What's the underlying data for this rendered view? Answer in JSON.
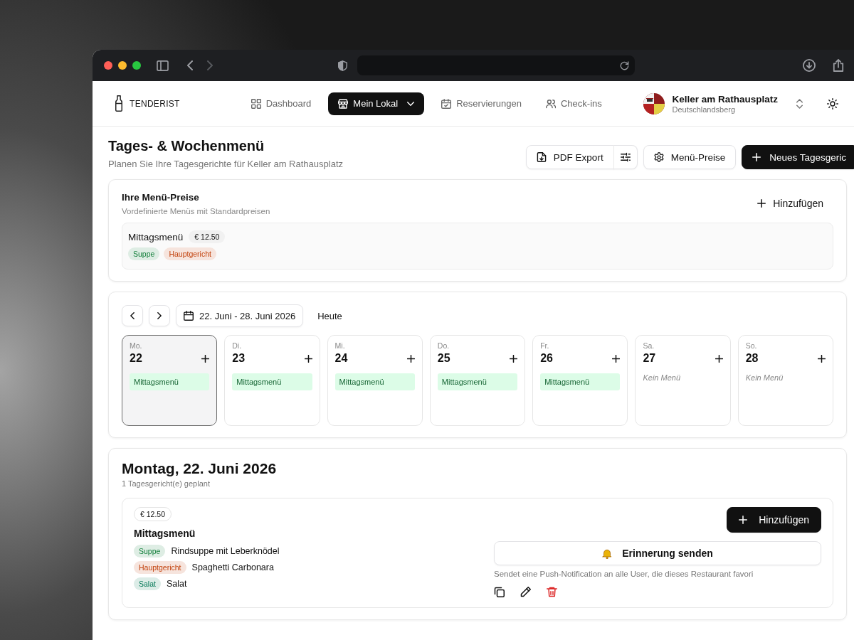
{
  "app_nav": {
    "brand": "TENDERIST",
    "items": [
      {
        "label": "Dashboard",
        "selected": false,
        "kind": "link"
      },
      {
        "label": "Mein Lokal",
        "selected": true,
        "kind": "dropdown"
      },
      {
        "label": "Reservierungen",
        "selected": false,
        "kind": "link"
      },
      {
        "label": "Check-ins",
        "selected": false,
        "kind": "link"
      }
    ],
    "restaurant": {
      "name": "Keller am Rathausplatz",
      "location": "Deutschlandsberg"
    }
  },
  "header": {
    "title": "Tages- & Wochenmenü",
    "subtitle": "Planen Sie Ihre Tagesgerichte für Keller am Rathausplatz",
    "actions": [
      {
        "label": "PDF Export",
        "kind": "split"
      },
      {
        "label": "Menü-Preise",
        "kind": "outline"
      },
      {
        "label": "Neues Tagesgeric",
        "kind": "primary"
      }
    ]
  },
  "menu_prices": {
    "title": "Ihre Menü-Preise",
    "subtitle": "Vordefinierte Menüs mit Standardpreisen",
    "add_label": "Hinzufügen",
    "menus": [
      {
        "name": "Mittagsmenü",
        "price": "€ 12.50",
        "courses": [
          {
            "label": "Suppe",
            "color": "#15803d"
          },
          {
            "label": "Hauptgericht",
            "color": "#c2410c"
          }
        ]
      }
    ]
  },
  "week": {
    "range": "22. Juni - 28. Juni 2026",
    "today_label": "Heute",
    "days": [
      {
        "weekday": "Mo.",
        "day": "22",
        "selected": true,
        "entries": [
          "Mittagsmenü"
        ]
      },
      {
        "weekday": "Di.",
        "day": "23",
        "selected": false,
        "entries": [
          "Mittagsmenü"
        ]
      },
      {
        "weekday": "Mi.",
        "day": "24",
        "selected": false,
        "entries": [
          "Mittagsmenü"
        ]
      },
      {
        "weekday": "Do.",
        "day": "25",
        "selected": false,
        "entries": [
          "Mittagsmenü"
        ]
      },
      {
        "weekday": "Fr.",
        "day": "26",
        "selected": false,
        "entries": [
          "Mittagsmenü"
        ]
      },
      {
        "weekday": "Sa.",
        "day": "27",
        "selected": false,
        "empty_label": "Kein Menü"
      },
      {
        "weekday": "So.",
        "day": "28",
        "selected": false,
        "empty_label": "Kein Menü"
      }
    ]
  },
  "day_detail": {
    "title": "Montag, 22. Juni 2026",
    "subtitle": "1 Tagesgericht(e) geplant",
    "dishes": [
      {
        "price": "€ 12.50",
        "name": "Mittagsmenü",
        "courses": [
          {
            "tag": "Suppe",
            "color": "#15803d",
            "dish": "Rindsuppe mit Leberknödel"
          },
          {
            "tag": "Hauptgericht",
            "color": "#c2410c",
            "dish": "Spaghetti Carbonara"
          },
          {
            "tag": "Salat",
            "color": "#047857",
            "dish": "Salat"
          }
        ],
        "add_label": "Hinzufügen",
        "reminder_label": "Erinnerung senden",
        "reminder_hint": "Sendet eine Push-Notification an alle User, die dieses Restaurant favori"
      }
    ]
  }
}
